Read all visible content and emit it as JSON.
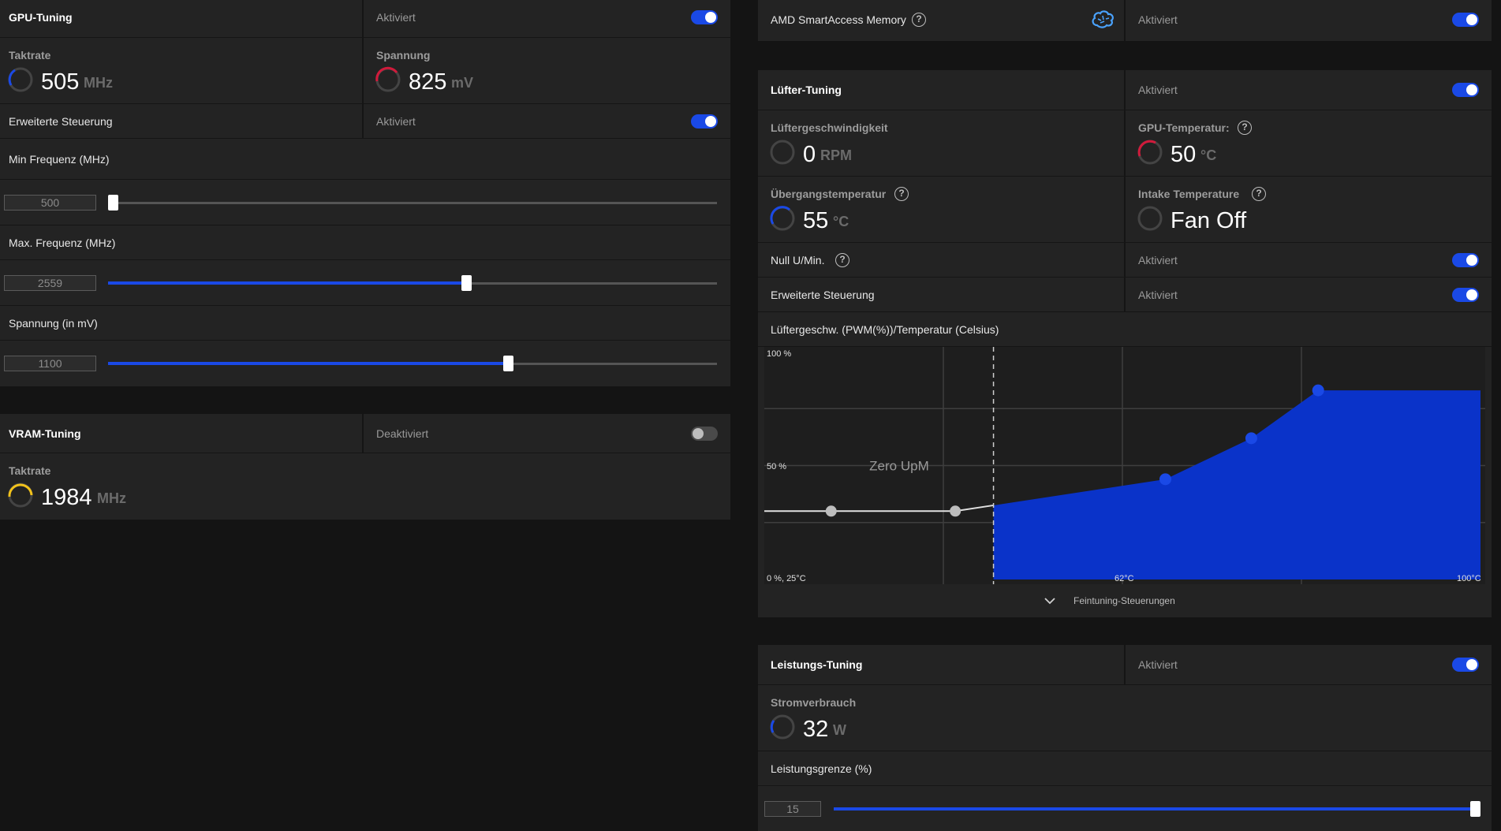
{
  "gpu_tuning": {
    "title": "GPU-Tuning",
    "state": "Aktiviert",
    "clock": {
      "label": "Taktrate",
      "value": "505",
      "unit": "MHz",
      "gauge_color": "#1a49e6"
    },
    "voltage": {
      "label": "Spannung",
      "value": "825",
      "unit": "mV",
      "gauge_color": "#d11a3b"
    },
    "advanced": {
      "label": "Erweiterte Steuerung",
      "state": "Aktiviert"
    },
    "min_freq": {
      "label": "Min Frequenz (MHz)",
      "value": "500",
      "fraction": 0.0
    },
    "max_freq": {
      "label": "Max. Frequenz (MHz)",
      "value": "2559",
      "fraction": 0.59
    },
    "voltage_limit": {
      "label": "Spannung (in mV)",
      "value": "1100",
      "fraction": 0.66
    }
  },
  "vram_tuning": {
    "title": "VRAM-Tuning",
    "state": "Deaktiviert",
    "clock": {
      "label": "Taktrate",
      "value": "1984",
      "unit": "MHz",
      "gauge_color": "#f2c21b"
    }
  },
  "sam": {
    "label": "AMD SmartAccess Memory",
    "state": "Aktiviert",
    "icon": "brain-icon"
  },
  "fan_tuning": {
    "title": "Lüfter-Tuning",
    "state": "Aktiviert",
    "fan_speed": {
      "label": "Lüftergeschwindigkeit",
      "value": "0",
      "unit": "RPM",
      "gauge_color": "#5a5a5a"
    },
    "gpu_temp": {
      "label": "GPU-Temperatur:",
      "value": "50",
      "unit": "°C",
      "gauge_color": "#d11a3b"
    },
    "junction_temp": {
      "label": "Übergangstemperatur",
      "value": "55",
      "unit": "°C",
      "gauge_color": "#1a49e6"
    },
    "intake_temp": {
      "label": "Intake Temperature",
      "value": "Fan Off",
      "gauge_color": "#5a5a5a"
    },
    "zero_rpm": {
      "label": "Null U/Min.",
      "state": "Aktiviert"
    },
    "advanced": {
      "label": "Erweiterte Steuerung",
      "state": "Aktiviert"
    },
    "curve_title": "Lüftergeschw. (PWM(%))/Temperatur (Celsius)",
    "fine_tuning": "Feintuning-Steuerungen"
  },
  "chart_data": {
    "type": "area",
    "ylabels": [
      "100 %",
      "50 %",
      "0 %, 25°C"
    ],
    "xlabels": [
      "62°C",
      "100°C"
    ],
    "annotation": "Zero UpM",
    "xlim": [
      25,
      100
    ],
    "ylim": [
      0,
      100
    ],
    "zero_rpm_threshold": 49,
    "points": [
      {
        "x": 32,
        "y": 30
      },
      {
        "x": 45,
        "y": 30
      },
      {
        "x": 67,
        "y": 44
      },
      {
        "x": 76,
        "y": 62
      },
      {
        "x": 83,
        "y": 83
      }
    ],
    "accent": "#1a49e6"
  },
  "power_tuning": {
    "title": "Leistungs-Tuning",
    "state": "Aktiviert",
    "power": {
      "label": "Stromverbrauch",
      "value": "32",
      "unit": "W",
      "gauge_color": "#1a49e6"
    },
    "limit": {
      "label": "Leistungsgrenze (%)",
      "value": "15",
      "fraction": 1.0
    }
  }
}
